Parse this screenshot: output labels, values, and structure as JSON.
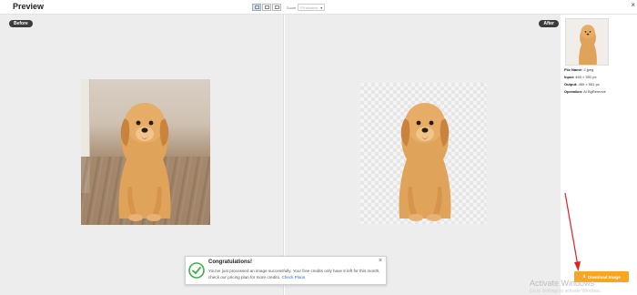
{
  "header": {
    "title": "Preview",
    "zoom_label": "Zoom",
    "zoom_value": "Fit window",
    "close_glyph": "×"
  },
  "panes": {
    "before_label": "Before",
    "after_label": "After"
  },
  "sidebar": {
    "file_name_label": "File Name:",
    "file_name_value": "2.jpeg",
    "input_label": "Input:",
    "input_value": "469 × 551 px",
    "output_label": "Output:",
    "output_value": "469 × 551 px",
    "operation_label": "Operation:",
    "operation_value": "AI BgRemove",
    "download_label": "Download Image"
  },
  "toast": {
    "title": "Congratulations!",
    "body": "You've just processed an image successfully. Your free credits only have 6 left for this month, check our pricing plan for more credits.",
    "link": "Check Plans",
    "close_glyph": "×"
  },
  "watermark": {
    "line1": "Activate Windows",
    "line2": "Go to Settings to activate Windows."
  },
  "colors": {
    "accent": "#f5a623",
    "success": "#3fae49",
    "annotation_arrow": "#e02020"
  }
}
